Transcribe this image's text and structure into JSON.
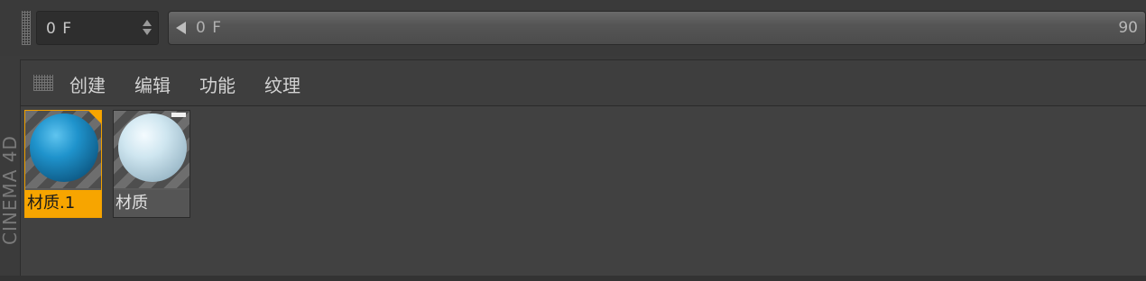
{
  "timeline": {
    "current_frame": "0 F",
    "slider_label": "0 F",
    "end_frame": "90"
  },
  "side_label": "CINEMA 4D",
  "menu": {
    "items": [
      {
        "label": "创建"
      },
      {
        "label": "编辑"
      },
      {
        "label": "功能"
      },
      {
        "label": "纹理"
      }
    ]
  },
  "materials": [
    {
      "name": "材质.1",
      "selected": true,
      "color": "#1e8fc8"
    },
    {
      "name": "材质",
      "selected": false,
      "color": "#cfe6f0"
    }
  ],
  "colors": {
    "accent": "#f7a500",
    "background": "#3b3b3b"
  }
}
